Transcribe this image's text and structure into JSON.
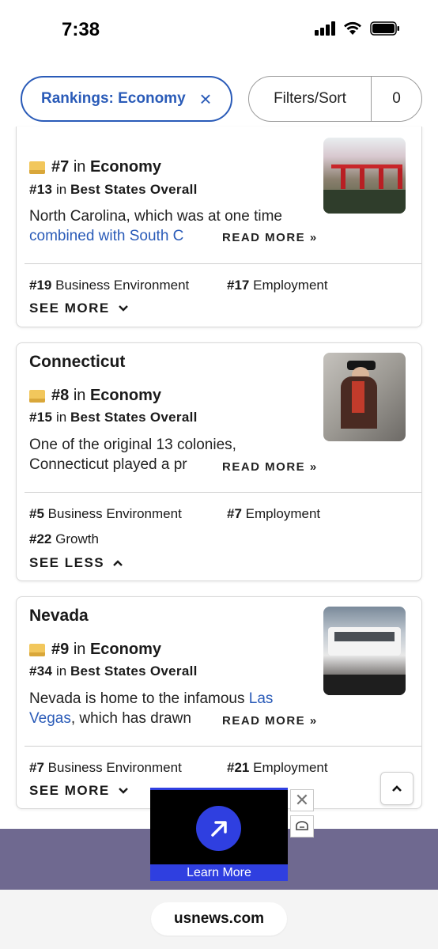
{
  "status_bar": {
    "time": "7:38",
    "icons": [
      "cellular-signal-icon",
      "wifi-icon",
      "battery-icon"
    ]
  },
  "filters": {
    "active_chip_label": "Rankings: Economy",
    "filter_sort_label": "Filters/Sort",
    "filter_count": "0"
  },
  "colors": {
    "brand_blue": "#2a5bb8",
    "ad_blue": "#2f3fe0",
    "ad_band": "#6f6990",
    "rank_flag": "#f2c75c"
  },
  "cards": [
    {
      "name": "",
      "rank_num": "#7",
      "rank_in": "in",
      "rank_category": "Economy",
      "overall_num": "#13",
      "overall_in": "in",
      "overall_label": "Best States Overall",
      "desc_text": "North Carolina, which was at one time",
      "desc_link": "combined with South C",
      "desc_after": "",
      "read_more": "READ MORE »",
      "sub_ranks": [
        {
          "num": "#19",
          "label": "Business Environment"
        },
        {
          "num": "#17",
          "label": "Employment"
        }
      ],
      "toggle_label": "SEE MORE",
      "toggle_icon": "chevron-down-icon"
    },
    {
      "name": "Connecticut",
      "rank_num": "#8",
      "rank_in": "in",
      "rank_category": "Economy",
      "overall_num": "#15",
      "overall_in": "in",
      "overall_label": "Best States Overall",
      "desc_text": "One of the original 13 colonies,",
      "desc_line2": "Connecticut played a pr",
      "read_more": "READ MORE »",
      "sub_ranks": [
        {
          "num": "#5",
          "label": "Business Environment"
        },
        {
          "num": "#7",
          "label": "Employment"
        },
        {
          "num": "#22",
          "label": "Growth"
        }
      ],
      "toggle_label": "SEE LESS",
      "toggle_icon": "chevron-up-icon"
    },
    {
      "name": "Nevada",
      "rank_num": "#9",
      "rank_in": "in",
      "rank_category": "Economy",
      "overall_num": "#34",
      "overall_in": "in",
      "overall_label": "Best States Overall",
      "desc_text": "Nevada is home to the infamous",
      "desc_link": "Las",
      "desc_link2": "Vegas",
      "desc_after": ", which has drawn",
      "read_more": "READ MORE »",
      "sub_ranks": [
        {
          "num": "#7",
          "label": "Business Environment"
        },
        {
          "num": "#21",
          "label": "Employment"
        }
      ],
      "toggle_label": "SEE MORE",
      "toggle_icon": "chevron-down-icon"
    }
  ],
  "ad": {
    "cta": "Learn More",
    "close": "✕"
  },
  "browser": {
    "url": "usnews.com"
  }
}
